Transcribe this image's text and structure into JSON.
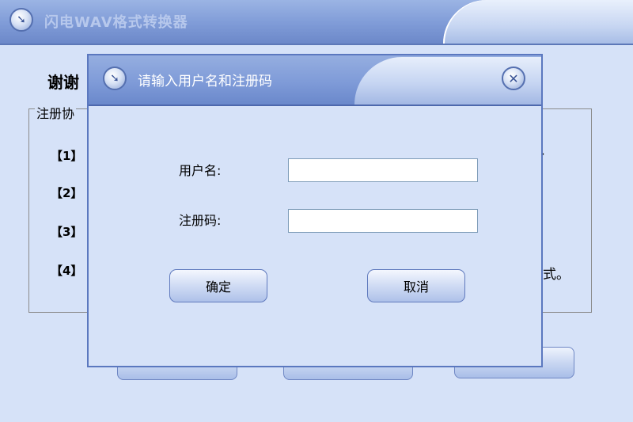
{
  "main_window": {
    "title": "闪电WAV格式转换器",
    "thanks_heading": "谢谢",
    "agreement_legend": "注册协",
    "items": [
      "【1】",
      "【2】",
      "【3】",
      "【4】"
    ],
    "partial_tail": "式。"
  },
  "dialog": {
    "title": "请输入用户名和注册码",
    "username_label": "用户名:",
    "regcode_label": "注册码:",
    "username_value": "",
    "regcode_value": "",
    "ok_label": "确定",
    "cancel_label": "取消",
    "close_icon": "close-x",
    "title_icon": "arrow-down-right"
  },
  "colors": {
    "titlebar": "#7f9bd7",
    "window_bg": "#d6e2f8",
    "border": "#5b78bf"
  }
}
